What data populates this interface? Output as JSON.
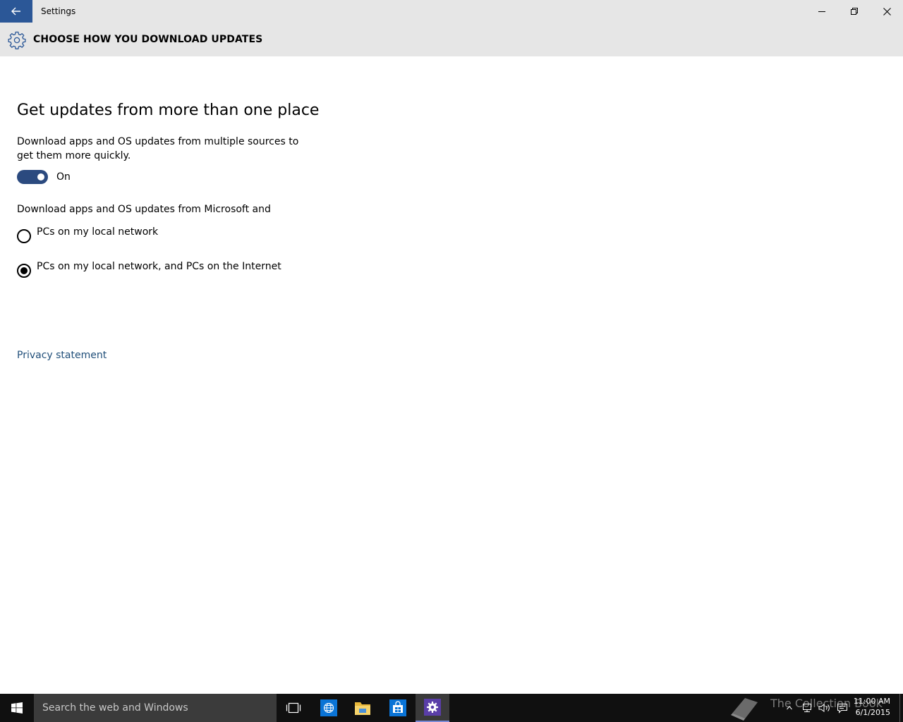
{
  "window": {
    "title": "Settings"
  },
  "header": {
    "title": "CHOOSE HOW YOU DOWNLOAD UPDATES",
    "icon": "gear-icon"
  },
  "section": {
    "title": "Get updates from more than one place",
    "description": "Download apps and OS updates from multiple sources to get them more quickly.",
    "toggle": {
      "state_label": "On",
      "checked": true
    },
    "sources_label": "Download apps and OS updates from Microsoft and",
    "options": [
      {
        "label": "PCs on my local network",
        "selected": false
      },
      {
        "label": "PCs on my local network, and PCs on the Internet",
        "selected": true
      }
    ],
    "privacy_link": "Privacy statement"
  },
  "taskbar": {
    "search_placeholder": "Search the web and Windows",
    "watermark": "The Collection Book",
    "clock": {
      "time": "11:00 AM",
      "date": "6/1/2015"
    }
  },
  "colors": {
    "accent": "#2b5797",
    "toggle_on": "#2b4a7f",
    "link": "#1f4e79",
    "chrome": "#e6e6e6",
    "taskbar": "#101010"
  }
}
